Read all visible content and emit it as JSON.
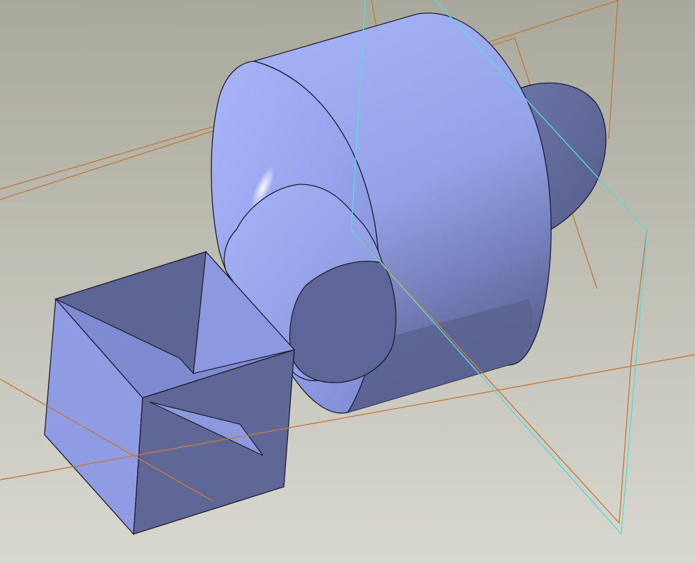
{
  "viewport": {
    "name": "cad-3d-viewport",
    "background_top": "#a9a89c",
    "background_bottom": "#d9d8cf"
  },
  "colors": {
    "face_light": "#a4b2f4",
    "face_mid": "#8e9be2",
    "face_dark": "#5c6493",
    "face_shadow": "#4f577f",
    "edge": "#1c1c2a",
    "datum_plane_orange": "#c47a3a",
    "datum_plane_cyan": "#58dada"
  },
  "model": {
    "features": [
      {
        "id": "cube",
        "icon": "cube-body"
      },
      {
        "id": "revolve",
        "icon": "revolved-body"
      },
      {
        "id": "cap",
        "icon": "ellipsoid-cap"
      }
    ]
  },
  "datum_planes": [
    {
      "id": "plane-1",
      "color_key": "datum_plane_orange"
    },
    {
      "id": "plane-2",
      "color_key": "datum_plane_orange"
    },
    {
      "id": "plane-3",
      "color_key": "datum_plane_cyan"
    }
  ]
}
